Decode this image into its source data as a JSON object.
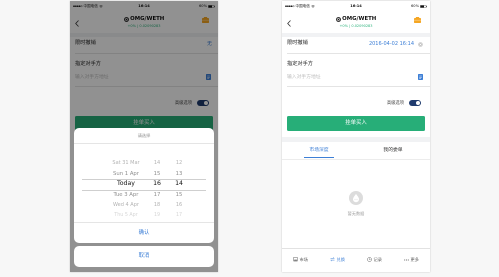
{
  "colors": {
    "accent": "#3d7fd6",
    "buy_green": "#27ae78",
    "price_green": "#2bb17b",
    "wallet_orange": "#f5a623",
    "toggle_on": "#1f3b6e",
    "overlay": "rgba(0,0,0,0.43)"
  },
  "left_phone": {
    "status_bar": {
      "carrier": "中国电信",
      "time": "16:14",
      "battery": "60%"
    },
    "nav": {
      "title": "OMG/WETH",
      "subtitle": "+0% | 0.02090283",
      "back_icon": "chevron-left-icon",
      "logo_icon": "omg-logo-icon",
      "wallet_icon": "wallet-icon"
    },
    "form": {
      "expiry_label": "限时撤销",
      "expiry_value": "无",
      "counterparty_label": "指定对手方",
      "counterparty_placeholder": "输入对手方地址",
      "address_book_icon": "address-book-icon",
      "advanced_label": "高级选项",
      "advanced_enabled": true,
      "submit_label": "挂单买入"
    },
    "picker": {
      "title": "请选择",
      "rows": [
        {
          "date": "Sat 31 Mar",
          "hour": "14",
          "minute": "12"
        },
        {
          "date": "Sun 1 Apr",
          "hour": "15",
          "minute": "13"
        },
        {
          "date": "Today",
          "hour": "16",
          "minute": "14"
        },
        {
          "date": "Tue 3 Apr",
          "hour": "17",
          "minute": "15"
        },
        {
          "date": "Wed 4 Apr",
          "hour": "18",
          "minute": "16"
        },
        {
          "date": "Thu 5 Apr",
          "hour": "19",
          "minute": "17"
        }
      ],
      "selected_index": 2,
      "confirm_label": "确认",
      "cancel_label": "取消"
    }
  },
  "right_phone": {
    "status_bar": {
      "carrier": "中国电信",
      "time": "16:14",
      "battery": "60%"
    },
    "nav": {
      "title": "OMG/WETH",
      "subtitle": "+0% | 0.02090283",
      "back_icon": "chevron-left-icon",
      "logo_icon": "omg-logo-icon",
      "wallet_icon": "wallet-icon"
    },
    "form": {
      "expiry_label": "限时撤销",
      "expiry_value": "2016-04-02 16:14",
      "clear_icon": "clear-icon",
      "counterparty_label": "指定对手方",
      "counterparty_placeholder": "输入对手方地址",
      "address_book_icon": "address-book-icon",
      "advanced_label": "高级选项",
      "advanced_enabled": true,
      "submit_label": "挂单买入"
    },
    "tabs": [
      {
        "label": "市场深度",
        "active": true
      },
      {
        "label": "我的委单",
        "active": false
      }
    ],
    "empty_state": {
      "text": "暂无数据",
      "icon": "empty-drop-icon"
    },
    "bottom_nav": [
      {
        "label": "市场",
        "icon": "market-icon",
        "active": false
      },
      {
        "label": "兑换",
        "icon": "swap-icon",
        "active": true
      },
      {
        "label": "记录",
        "icon": "history-icon",
        "active": false
      },
      {
        "label": "更多",
        "icon": "more-icon",
        "active": false
      }
    ]
  }
}
